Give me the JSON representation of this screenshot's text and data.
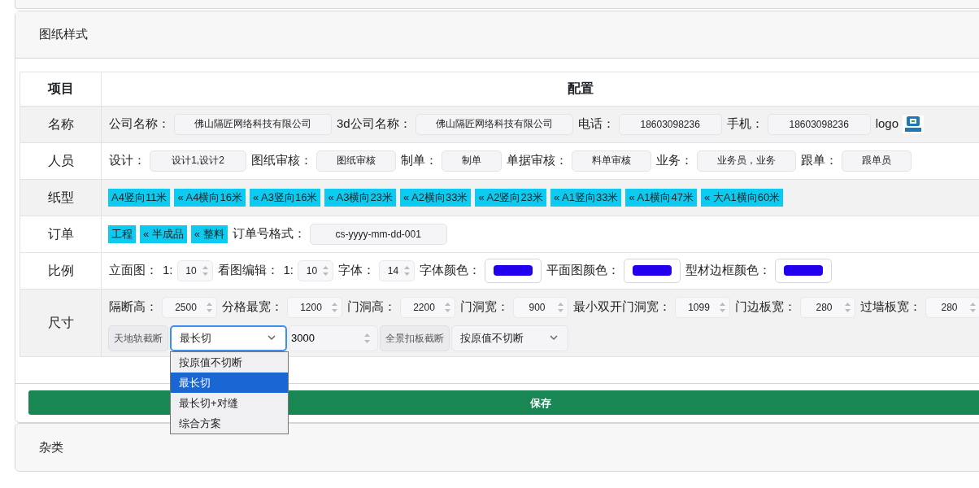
{
  "section": {
    "title": "图纸样式"
  },
  "table": {
    "columns": [
      "项目",
      "配置"
    ],
    "rows": [
      {
        "name": "名称",
        "shaded": true,
        "lines": [
          [
            {
              "kind": "text",
              "label": "公司名称：",
              "value": "佛山隔匠网络科技有限公司"
            },
            {
              "kind": "text",
              "label": "3d公司名称：",
              "value": "佛山隔匠网络科技有限公司"
            },
            {
              "kind": "text",
              "label": "电话：",
              "value": "18603098236"
            },
            {
              "kind": "text",
              "label": "手机：",
              "value": "18603098236"
            },
            {
              "kind": "logo",
              "label": "logo"
            }
          ]
        ]
      },
      {
        "name": "人员",
        "shaded": false,
        "lines": [
          [
            {
              "kind": "text",
              "label": "设计：",
              "value": "设计1,设计2"
            },
            {
              "kind": "text",
              "label": "图纸审核：",
              "value": "图纸审核"
            },
            {
              "kind": "text",
              "label": "制单：",
              "value": "制单"
            },
            {
              "kind": "text",
              "label": "单据审核：",
              "value": "料单审核"
            },
            {
              "kind": "text",
              "label": "业务：",
              "value": "业务员，业务"
            },
            {
              "kind": "text",
              "label": "跟单：",
              "value": "跟单员"
            }
          ]
        ]
      },
      {
        "name": "纸型",
        "shaded": true,
        "lines": [
          [
            {
              "kind": "tag",
              "text": "A4竖向11米"
            },
            {
              "kind": "tag",
              "text": "« A4横向16米"
            },
            {
              "kind": "tag",
              "text": "« A3竖向16米"
            },
            {
              "kind": "tag",
              "text": "« A3横向23米"
            },
            {
              "kind": "tag",
              "text": "« A2横向33米"
            },
            {
              "kind": "tag",
              "text": "« A2竖向23米"
            },
            {
              "kind": "tag",
              "text": "« A1竖向33米"
            },
            {
              "kind": "tag",
              "text": "« A1横向47米"
            },
            {
              "kind": "tag",
              "text": "« 大A1横向60米"
            }
          ]
        ]
      },
      {
        "name": "订单",
        "shaded": false,
        "lines": [
          [
            {
              "kind": "tag",
              "text": "工程"
            },
            {
              "kind": "tag",
              "text": "« 半成品"
            },
            {
              "kind": "tag",
              "text": "« 整料"
            },
            {
              "kind": "text",
              "label": "订单号格式：",
              "value": "cs-yyyy-mm-dd-001"
            }
          ]
        ]
      },
      {
        "name": "比例",
        "shaded": false,
        "lines": [
          [
            {
              "kind": "number",
              "label": "立面图：",
              "prefix": "1:",
              "value": "10"
            },
            {
              "kind": "number",
              "label": "看图编辑：",
              "prefix": "1:",
              "value": "10"
            },
            {
              "kind": "number",
              "label": "字体：",
              "value": "14"
            },
            {
              "kind": "color",
              "label": "字体颜色：",
              "color": "#2200ee"
            },
            {
              "kind": "color",
              "label": "平面图颜色：",
              "color": "#2200ee"
            },
            {
              "kind": "color",
              "label": "型材边框颜色：",
              "color": "#2200ee"
            }
          ]
        ]
      },
      {
        "name": "尺寸",
        "shaded": true,
        "lines": [
          [
            {
              "kind": "number",
              "label": "隔断高：",
              "value": "2500"
            },
            {
              "kind": "number",
              "label": "分格最宽：",
              "value": "1200"
            },
            {
              "kind": "number",
              "label": "门洞高：",
              "value": "2200"
            },
            {
              "kind": "number",
              "label": "门洞宽：",
              "value": "900"
            },
            {
              "kind": "number",
              "label": "最小双开门洞宽：",
              "value": "1099"
            },
            {
              "kind": "number",
              "label": "门边板宽：",
              "value": "280"
            },
            {
              "kind": "number",
              "label": "过墙板宽：",
              "value": "280"
            }
          ],
          [
            {
              "kind": "group",
              "items": [
                {
                  "kind": "addon",
                  "text": "天地轨截断"
                },
                {
                  "kind": "select",
                  "value": "最长切",
                  "focused": true,
                  "options": [
                    {
                      "label": "按原值不切断",
                      "selected": false
                    },
                    {
                      "label": "最长切",
                      "selected": true
                    },
                    {
                      "label": "最长切+对缝",
                      "selected": false
                    },
                    {
                      "label": "综合方案",
                      "selected": false
                    }
                  ]
                },
                {
                  "kind": "number",
                  "value": "3000"
                },
                {
                  "kind": "addon",
                  "text": "全景扣板截断"
                },
                {
                  "kind": "select",
                  "value": "按原值不切断",
                  "focused": false
                }
              ]
            }
          ]
        ]
      }
    ]
  },
  "save_button": "保存",
  "next_section": {
    "title": "杂类"
  }
}
